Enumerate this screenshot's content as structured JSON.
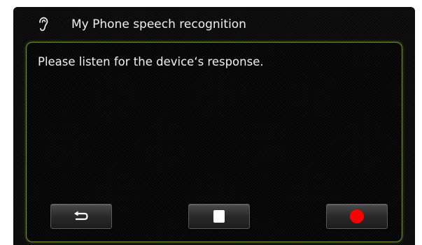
{
  "header": {
    "title": "My Phone speech recognition",
    "icon": "ear-icon"
  },
  "main": {
    "message": "Please listen for the device‘s response."
  },
  "controls": [
    {
      "name": "back",
      "icon": "return-arrow-icon"
    },
    {
      "name": "stop",
      "icon": "stop-icon"
    },
    {
      "name": "record",
      "icon": "record-icon"
    }
  ],
  "colors": {
    "background": "#0a0a0a",
    "panel_border": "#6b8a3a",
    "text": "#f0f0f0",
    "record": "#ff0000"
  }
}
